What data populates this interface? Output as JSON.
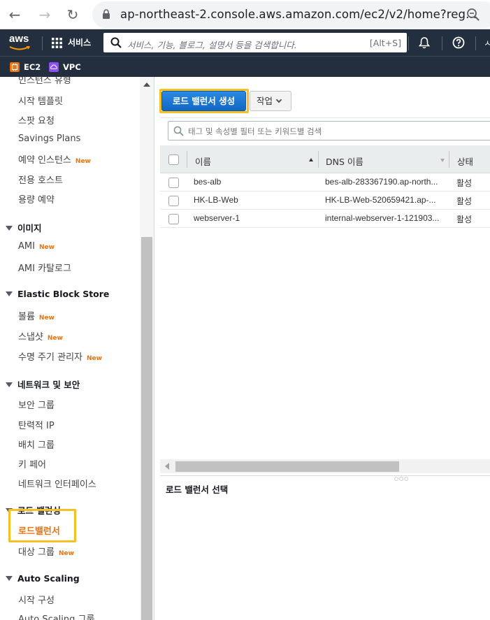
{
  "browser": {
    "url": "ap-northeast-2.console.aws.amazon.com/ec2/v2/home?reg..."
  },
  "aws_nav": {
    "logo": "aws",
    "services_label": "서비스",
    "search_placeholder": "서비스, 기능, 블로그, 설명서 등을 검색합니다.",
    "search_shortcut": "[Alt+S]",
    "clipped_text": "ㅅ"
  },
  "favorites": [
    {
      "label": "EC2",
      "color": "#ec7211"
    },
    {
      "label": "VPC",
      "color": "#8c4fff"
    }
  ],
  "sidebar": {
    "items": [
      {
        "label": "인스턴스 유형",
        "new": ""
      },
      {
        "label": "시작 템플릿",
        "new": ""
      },
      {
        "label": "스팟 요청",
        "new": ""
      },
      {
        "label": "Savings Plans",
        "new": ""
      },
      {
        "label": "예약 인스턴스",
        "new": "New"
      },
      {
        "label": "전용 호스트",
        "new": ""
      },
      {
        "label": "용량 예약",
        "new": ""
      }
    ],
    "images_header": "이미지",
    "images": [
      {
        "label": "AMI",
        "new": "New"
      },
      {
        "label": "AMI 카탈로그",
        "new": ""
      }
    ],
    "ebs_header": "Elastic Block Store",
    "ebs": [
      {
        "label": "볼륨",
        "new": "New"
      },
      {
        "label": "스냅샷",
        "new": "New"
      },
      {
        "label": "수명 주기 관리자",
        "new": "New"
      }
    ],
    "network_header": "네트워크 및 보안",
    "network": [
      {
        "label": "보안 그룹",
        "new": ""
      },
      {
        "label": "탄력적 IP",
        "new": ""
      },
      {
        "label": "배치 그룹",
        "new": ""
      },
      {
        "label": "키 페어",
        "new": ""
      },
      {
        "label": "네트워크 인터페이스",
        "new": ""
      }
    ],
    "lb_header": "로드 밸런싱",
    "lb": [
      {
        "label": "로드밸런서",
        "new": ""
      },
      {
        "label": "대상 그룹",
        "new": "New"
      }
    ],
    "asg_header": "Auto Scaling",
    "asg": [
      {
        "label": "시작 구성",
        "new": ""
      },
      {
        "label": "Auto Scaling 그룹",
        "new": ""
      }
    ]
  },
  "toolbar": {
    "create_label": "로드 밸런서 생성",
    "action_label": "작업"
  },
  "filter": {
    "placeholder": "태그 및 속성별 필터 또는 키워드별 검색"
  },
  "table": {
    "headers": [
      "이름",
      "DNS 이름",
      "상태"
    ],
    "rows": [
      {
        "name": "bes-alb",
        "dns": "bes-alb-283367190.ap-north...",
        "state": "활성"
      },
      {
        "name": "HK-LB-Web",
        "dns": "HK-LB-Web-520659421.ap-...",
        "state": "활성"
      },
      {
        "name": "webserver-1",
        "dns": "internal-webserver-1-121903...",
        "state": "활성"
      }
    ]
  },
  "detail": {
    "title": "로드 밸런서 선택"
  },
  "colors": {
    "aws_nav": "#232f3e",
    "accent_orange": "#ec7211",
    "primary_blue": "#0972d3",
    "highlight_yellow": "#f5c023"
  }
}
